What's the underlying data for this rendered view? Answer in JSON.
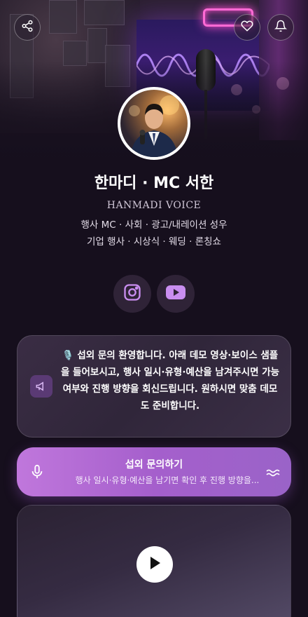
{
  "profile": {
    "name": "한마디 · MC 서한",
    "brand": "HANMADI VOICE",
    "tagline_1": "행사 MC · 사회 · 광고/내레이션 성우",
    "tagline_2": "기업 행사 · 시상식 · 웨딩 · 론칭쇼"
  },
  "header": {
    "share_icon": "share-icon",
    "favorite_icon": "heart-icon",
    "notification_icon": "bell-icon"
  },
  "social": [
    "instagram-icon",
    "youtube-icon"
  ],
  "notice": {
    "icon": "megaphone-icon",
    "text": "🎙️ 섭외 문의 환영합니다. 아래 데모 영상·보이스 샘플을 들어보시고, 행사 일시·유형·예산을 남겨주시면 가능 여부와 진행 방향을 회신드립니다. 원하시면 맞춤 데모도 준비합니다."
  },
  "cta": {
    "title": "섭외 문의하기",
    "subtitle": "행사 일시·유형·예산을 남기면 확인 후 진행 방향을...",
    "icon": "microphone-icon",
    "wave_icon": "wave-icon"
  },
  "video": {
    "play_icon": "play-icon"
  },
  "colors": {
    "background": "#160f1d",
    "cta_gradient_start": "#c077dc",
    "cta_gradient_end": "#9a63c8",
    "card": "#33283d"
  }
}
